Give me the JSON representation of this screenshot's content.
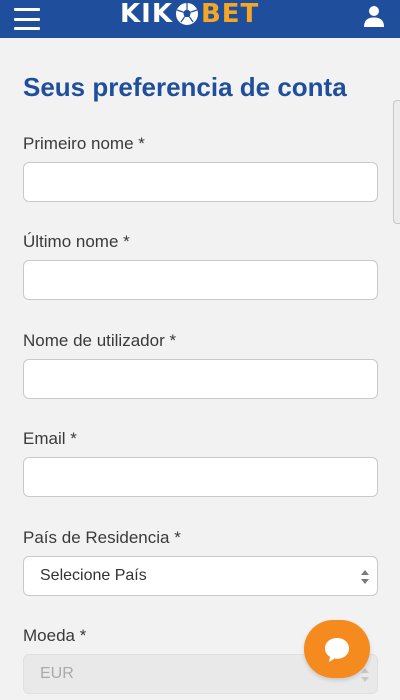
{
  "header": {
    "logo_left": "KIK",
    "logo_right": "BET",
    "menu_icon": "hamburger-menu-icon",
    "user_icon": "user-icon",
    "background_color": "#1f4f9c",
    "accent_color": "#f5a623"
  },
  "page": {
    "title": "Seus preferencia de conta"
  },
  "form": {
    "first_name": {
      "label": "Primeiro nome *",
      "value": ""
    },
    "last_name": {
      "label": "Último nome *",
      "value": ""
    },
    "username": {
      "label": "Nome de utilizador *",
      "value": ""
    },
    "email": {
      "label": "Email *",
      "value": ""
    },
    "country": {
      "label": "País de Residencia *",
      "selected": "Selecione País"
    },
    "currency": {
      "label": "Moeda *",
      "selected": "EUR",
      "disabled": true
    }
  },
  "chat": {
    "icon": "chat-bubble-icon",
    "color": "#f58a1f"
  }
}
